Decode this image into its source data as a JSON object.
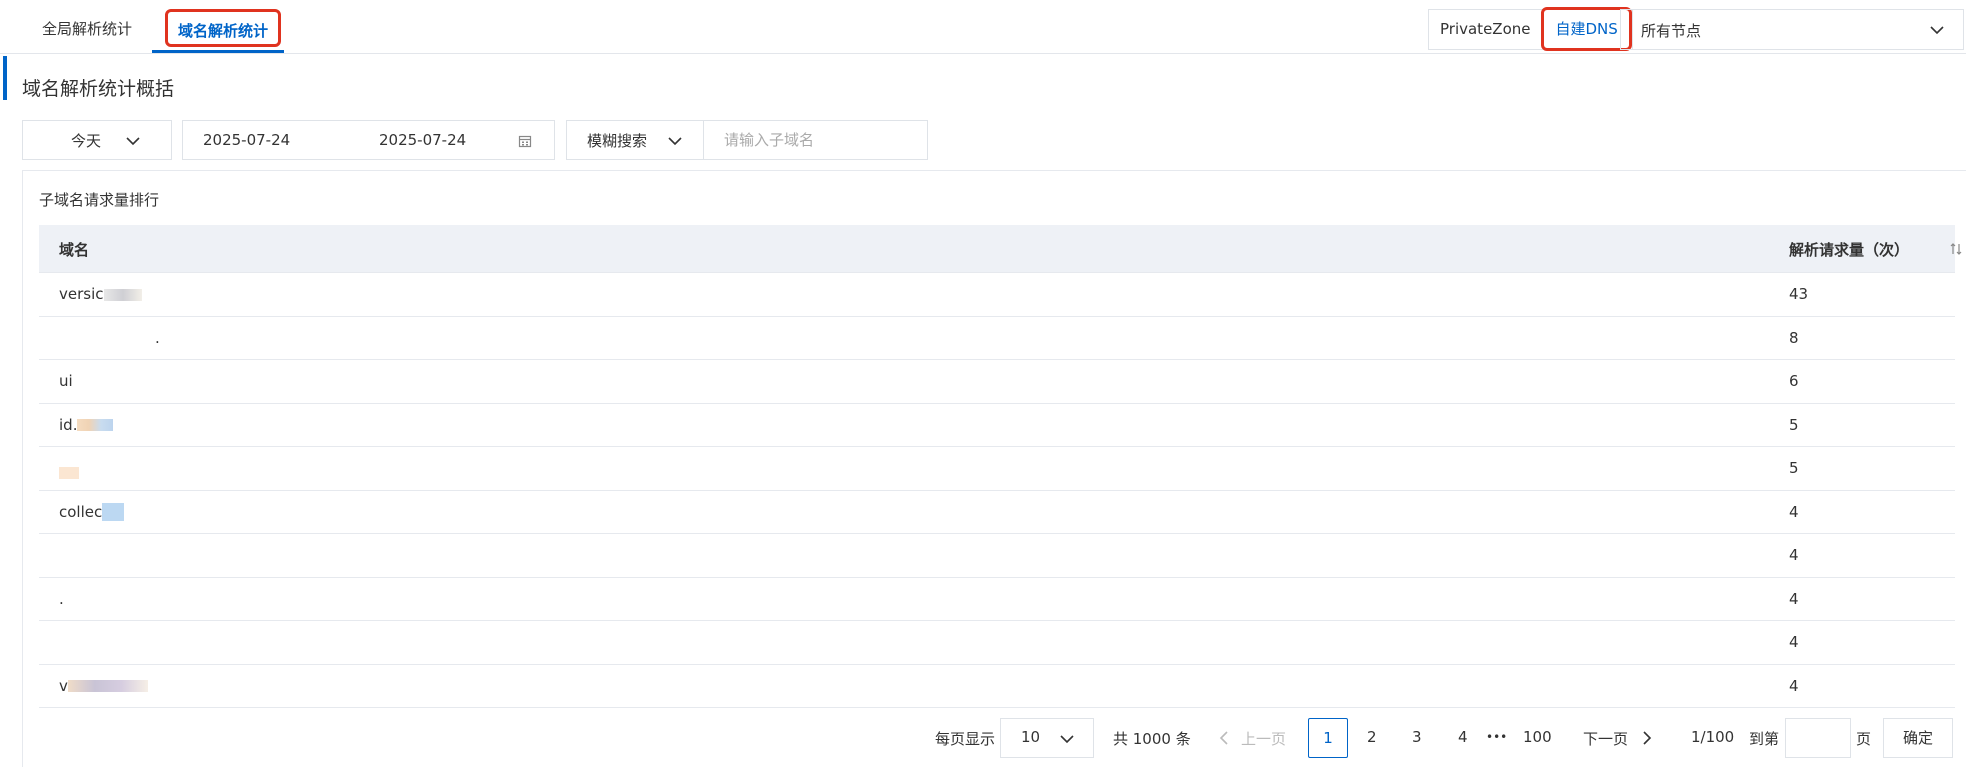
{
  "tabs": [
    {
      "label": "全局解析统计"
    },
    {
      "label": "域名解析统计"
    }
  ],
  "env": {
    "private_zone": "PrivateZone",
    "self_dns": "自建DNS"
  },
  "node_select": {
    "value": "所有节点"
  },
  "section_title": "域名解析统计概括",
  "filters": {
    "range": "今天",
    "date_start": "2025-07-24",
    "date_end": "2025-07-24",
    "search_mode": "模糊搜索",
    "search_placeholder": "请输入子域名"
  },
  "card_title": "子域名请求量排行",
  "table": {
    "col_domain": "域名",
    "col_count": "解析请求量（次）",
    "rows": [
      {
        "domain": "versic",
        "count": "43"
      },
      {
        "domain": ".",
        "count": "8"
      },
      {
        "domain": "ui",
        "count": "6"
      },
      {
        "domain": "id.",
        "count": "5"
      },
      {
        "domain": "",
        "count": "5"
      },
      {
        "domain": "collec",
        "count": "4"
      },
      {
        "domain": "",
        "count": "4"
      },
      {
        "domain": ".",
        "count": "4"
      },
      {
        "domain": "",
        "count": "4"
      },
      {
        "domain": "v",
        "count": "4"
      }
    ]
  },
  "pager": {
    "per_page_label": "每页显示",
    "per_page": "10",
    "total": "共 1000 条",
    "prev": "上一页",
    "pages": [
      "1",
      "2",
      "3",
      "4"
    ],
    "ellipsis": "•••",
    "last": "100",
    "next": "下一页",
    "page_status": "1/100",
    "goto_label": "到第",
    "page_suffix": "页",
    "confirm": "确定"
  },
  "colors": {
    "accent": "#0064c8",
    "highlight": "#e0331f"
  }
}
